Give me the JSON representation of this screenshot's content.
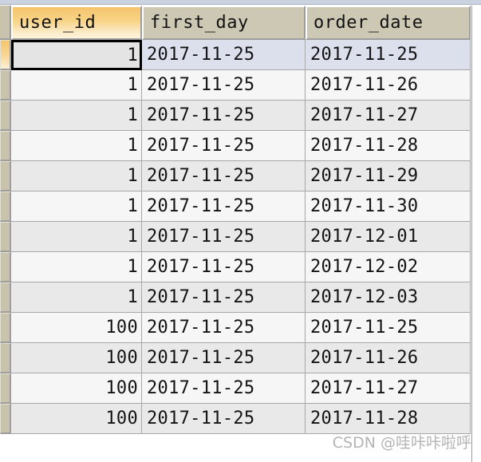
{
  "window": {
    "kind": "sql-result-grid",
    "accent_selected_header": "#f5c46a",
    "header_background": "#cdc8b4",
    "selected_row_background": "#dcdfec",
    "stripe_odd": "#e9e9e9",
    "stripe_even": "#f6f6f6",
    "gutter_background": "#c9c2ac"
  },
  "table": {
    "columns": [
      {
        "key": "user_id",
        "label": "user_id",
        "align": "right",
        "selected": true
      },
      {
        "key": "first_day",
        "label": "first_day",
        "align": "left",
        "selected": false
      },
      {
        "key": "order_date",
        "label": "order_date",
        "align": "left",
        "selected": false
      }
    ],
    "rows": [
      {
        "user_id": "1",
        "first_day": "2017-11-25",
        "order_date": "2017-11-25",
        "selected": true
      },
      {
        "user_id": "1",
        "first_day": "2017-11-25",
        "order_date": "2017-11-26",
        "selected": false
      },
      {
        "user_id": "1",
        "first_day": "2017-11-25",
        "order_date": "2017-11-27",
        "selected": false
      },
      {
        "user_id": "1",
        "first_day": "2017-11-25",
        "order_date": "2017-11-28",
        "selected": false
      },
      {
        "user_id": "1",
        "first_day": "2017-11-25",
        "order_date": "2017-11-29",
        "selected": false
      },
      {
        "user_id": "1",
        "first_day": "2017-11-25",
        "order_date": "2017-11-30",
        "selected": false
      },
      {
        "user_id": "1",
        "first_day": "2017-11-25",
        "order_date": "2017-12-01",
        "selected": false
      },
      {
        "user_id": "1",
        "first_day": "2017-11-25",
        "order_date": "2017-12-02",
        "selected": false
      },
      {
        "user_id": "1",
        "first_day": "2017-11-25",
        "order_date": "2017-12-03",
        "selected": false
      },
      {
        "user_id": "100",
        "first_day": "2017-11-25",
        "order_date": "2017-11-25",
        "selected": false
      },
      {
        "user_id": "100",
        "first_day": "2017-11-25",
        "order_date": "2017-11-26",
        "selected": false
      },
      {
        "user_id": "100",
        "first_day": "2017-11-25",
        "order_date": "2017-11-27",
        "selected": false
      },
      {
        "user_id": "100",
        "first_day": "2017-11-25",
        "order_date": "2017-11-28",
        "selected": false
      }
    ],
    "focused_cell": {
      "row": 0,
      "column": "user_id",
      "value": "1"
    }
  },
  "watermark": {
    "text": "CSDN @哇咔咔啦呼"
  }
}
